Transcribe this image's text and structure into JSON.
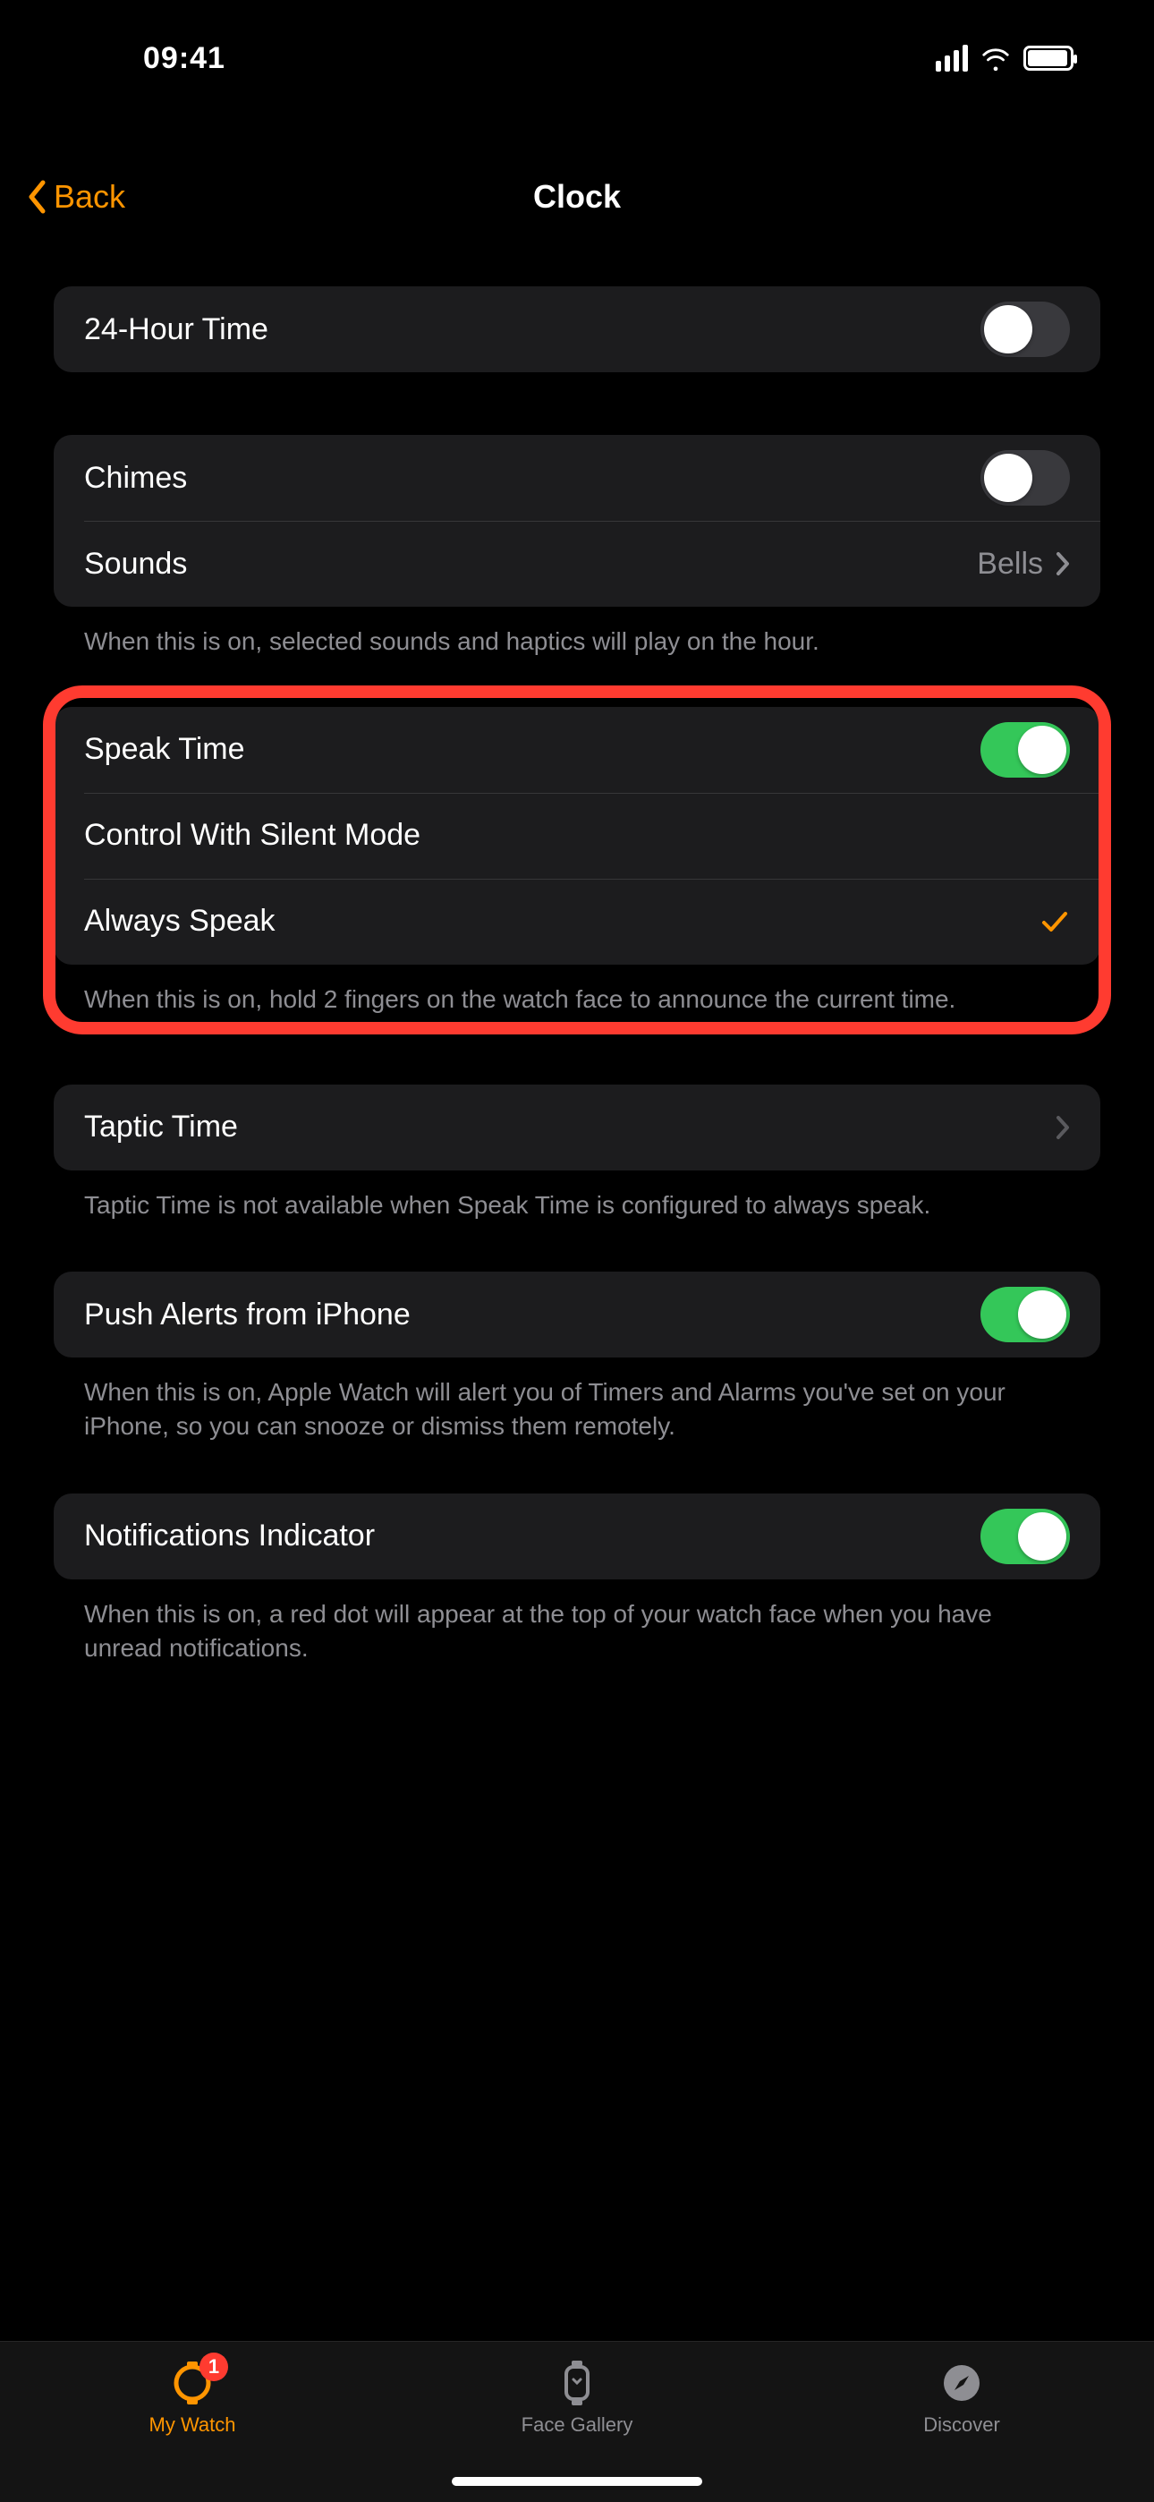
{
  "status": {
    "time": "09:41"
  },
  "nav": {
    "back": "Back",
    "title": "Clock"
  },
  "rows": {
    "twentyFour": {
      "label": "24-Hour Time",
      "on": false
    },
    "chimes": {
      "label": "Chimes",
      "on": false
    },
    "sounds": {
      "label": "Sounds",
      "value": "Bells"
    },
    "soundsFooter": "When this is on, selected sounds and haptics will play on the hour.",
    "speakTime": {
      "label": "Speak Time",
      "on": true
    },
    "controlSilent": {
      "label": "Control With Silent Mode"
    },
    "alwaysSpeak": {
      "label": "Always Speak",
      "checked": true
    },
    "speakFooter": "When this is on, hold 2 fingers on the watch face to announce the current time.",
    "tapticTime": {
      "label": "Taptic Time"
    },
    "tapticFooter": "Taptic Time is not available when Speak Time is configured to always speak.",
    "pushAlerts": {
      "label": "Push Alerts from iPhone",
      "on": true
    },
    "pushFooter": "When this is on, Apple Watch will alert you of Timers and Alarms you've set on your iPhone, so you can snooze or dismiss them remotely.",
    "notifIndicator": {
      "label": "Notifications Indicator",
      "on": true
    },
    "notifFooter": "When this is on, a red dot will appear at the top of your watch face when you have unread notifications."
  },
  "tabs": {
    "myWatch": {
      "label": "My Watch",
      "badge": "1"
    },
    "faceGallery": {
      "label": "Face Gallery"
    },
    "discover": {
      "label": "Discover"
    }
  },
  "colors": {
    "accent": "#ff9500",
    "green": "#34c759",
    "red": "#ff3b30"
  }
}
